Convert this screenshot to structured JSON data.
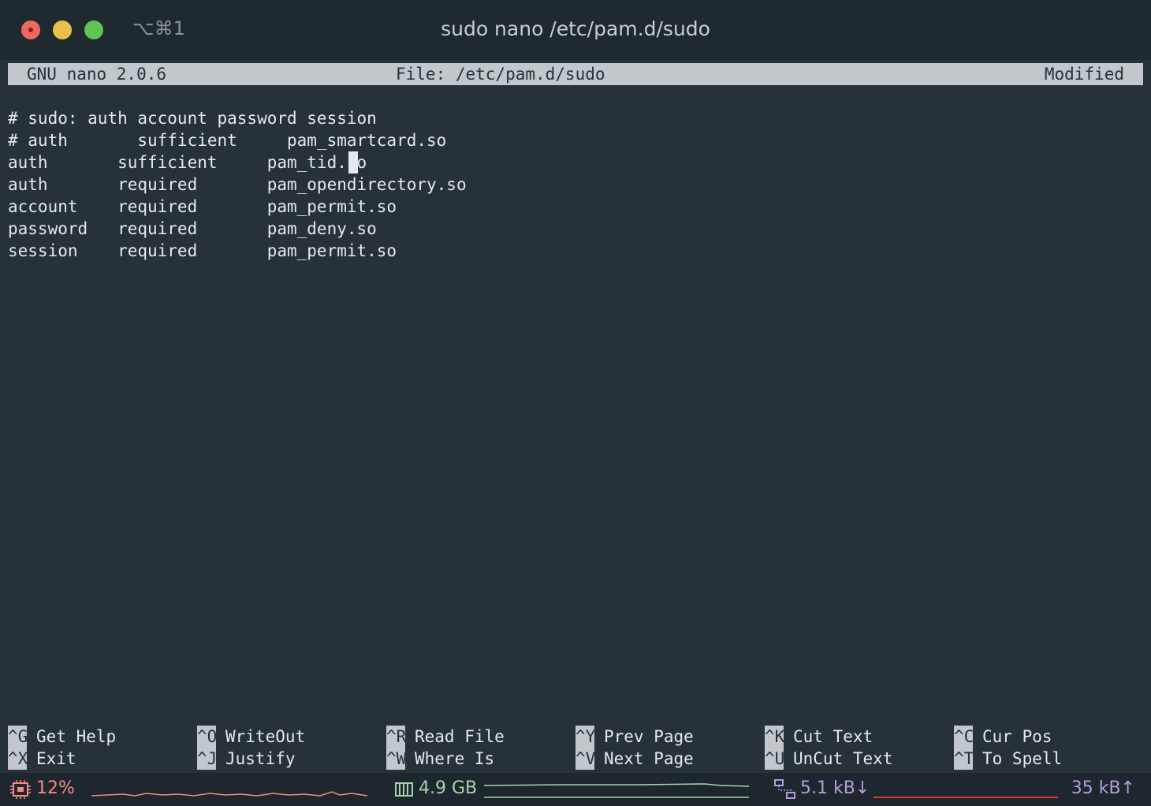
{
  "window": {
    "shortcut": "⌥⌘1",
    "title": "sudo nano /etc/pam.d/sudo"
  },
  "nano": {
    "version": "GNU nano 2.0.6",
    "file_label": "File: /etc/pam.d/sudo",
    "status": "Modified"
  },
  "file_lines": [
    "# sudo: auth account password session",
    "# auth       sufficient     pam_smartcard.so",
    "auth       sufficient     pam_tid.so",
    "auth       required       pam_opendirectory.so",
    "account    required       pam_permit.so",
    "password   required       pam_deny.so",
    "session    required       pam_permit.so"
  ],
  "shortcuts": [
    [
      {
        "key": "^G",
        "label": "Get Help"
      },
      {
        "key": "^O",
        "label": "WriteOut"
      },
      {
        "key": "^R",
        "label": "Read File"
      },
      {
        "key": "^Y",
        "label": "Prev Page"
      },
      {
        "key": "^K",
        "label": "Cut Text"
      },
      {
        "key": "^C",
        "label": "Cur Pos"
      }
    ],
    [
      {
        "key": "^X",
        "label": "Exit"
      },
      {
        "key": "^J",
        "label": "Justify"
      },
      {
        "key": "^W",
        "label": "Where Is"
      },
      {
        "key": "^V",
        "label": "Next Page"
      },
      {
        "key": "^U",
        "label": "UnCut Text"
      },
      {
        "key": "^T",
        "label": "To Spell"
      }
    ]
  ],
  "status_bar": {
    "cpu": "12%",
    "memory": "4.9 GB",
    "net_down": "5.1 kB↓",
    "net_up": "35 kB↑"
  },
  "colors": {
    "background": "#263238",
    "text": "#e6e9eb",
    "cpu": "#f28b82",
    "memory": "#a5d6a7",
    "network": "#b39ddb",
    "net_graph": "#e53935"
  }
}
